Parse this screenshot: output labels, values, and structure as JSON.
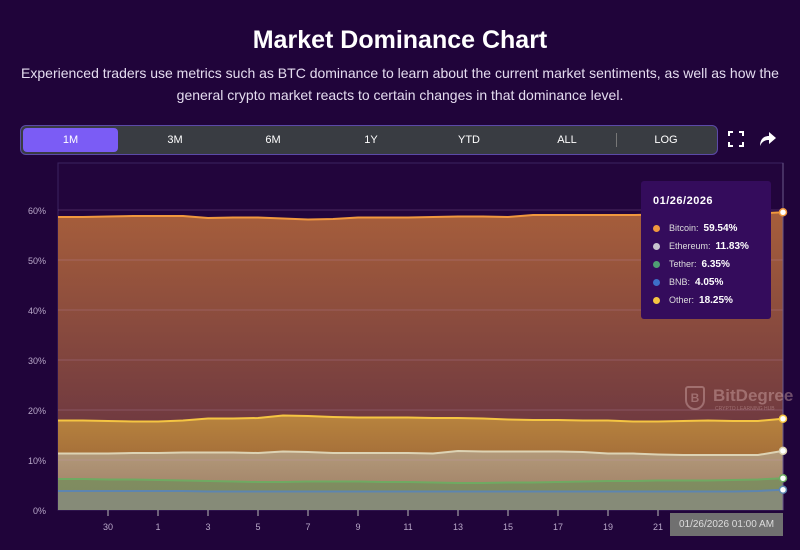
{
  "header": {
    "title": "Market Dominance Chart",
    "subtitle": "Experienced traders use metrics such as BTC dominance to learn about the current market sentiments, as well as how the general crypto market reacts to certain changes in that dominance level."
  },
  "toolbar": {
    "ranges": [
      "1M",
      "3M",
      "6M",
      "1Y",
      "YTD",
      "ALL"
    ],
    "active": "1M",
    "log": "LOG",
    "icons": [
      "fullscreen-icon",
      "share-icon"
    ]
  },
  "tooltip": {
    "date": "01/26/2026",
    "items": [
      {
        "name": "Bitcoin:",
        "value": "59.54%",
        "color": "#f0983e"
      },
      {
        "name": "Ethereum:",
        "value": "11.83%",
        "color": "#c8c4d0"
      },
      {
        "name": "Tether:",
        "value": "6.35%",
        "color": "#4f9e74"
      },
      {
        "name": "BNB:",
        "value": "4.05%",
        "color": "#3d6fc8"
      },
      {
        "name": "Other:",
        "value": "18.25%",
        "color": "#f5c542"
      }
    ]
  },
  "crosshair_label": "01/26/2026 01:00 AM",
  "watermark": {
    "brand": "BitDegree",
    "tagline": "CRYPTO LEARNING HUB"
  },
  "chart_data": {
    "type": "area",
    "title": "Market Dominance Chart",
    "x_start": "12/28",
    "x_tick_labels": [
      "30",
      "1",
      "3",
      "5",
      "7",
      "9",
      "11",
      "13",
      "15",
      "17",
      "19",
      "21"
    ],
    "y_tick_labels": [
      "0%",
      "10%",
      "20%",
      "30%",
      "40%",
      "50%",
      "60%"
    ],
    "ylim": [
      0,
      68
    ],
    "grid": true,
    "series": [
      {
        "name": "Bitcoin",
        "line": "#f0983e",
        "fill": [
          "#a65e3b",
          "#5a2b42"
        ],
        "values": [
          58.6,
          58.6,
          58.7,
          58.8,
          58.8,
          58.8,
          58.4,
          58.5,
          58.5,
          58.3,
          58.1,
          58.2,
          58.5,
          58.5,
          58.5,
          58.6,
          58.7,
          58.7,
          58.6,
          59.0,
          59.0,
          59.0,
          59.0,
          59.0,
          59.1,
          59.1,
          59.2,
          59.2,
          59.3,
          59.54
        ]
      },
      {
        "name": "Other",
        "line": "#f5c542",
        "fill": [
          "#b8843e",
          "#8d5434"
        ],
        "values": [
          17.9,
          17.9,
          17.8,
          17.7,
          17.7,
          17.9,
          18.3,
          18.3,
          18.4,
          18.9,
          18.8,
          18.6,
          18.5,
          18.5,
          18.5,
          18.4,
          18.4,
          18.3,
          18.1,
          18.0,
          18.0,
          17.9,
          17.9,
          17.7,
          17.7,
          17.8,
          17.9,
          17.8,
          17.8,
          18.25
        ]
      },
      {
        "name": "Ethereum",
        "line": "#ddd3b4",
        "fill": [
          "#b39a7a",
          "#9a7860"
        ],
        "values": [
          11.3,
          11.3,
          11.3,
          11.4,
          11.4,
          11.5,
          11.5,
          11.5,
          11.4,
          11.7,
          11.6,
          11.4,
          11.4,
          11.4,
          11.4,
          11.3,
          11.8,
          11.7,
          11.7,
          11.7,
          11.7,
          11.6,
          11.3,
          11.3,
          11.1,
          11.0,
          11.0,
          11.0,
          11.0,
          11.83
        ]
      },
      {
        "name": "Tether",
        "line": "#6faa62",
        "fill": [
          "#808c60",
          "#7d8a60"
        ],
        "values": [
          6.2,
          6.2,
          6.1,
          6.1,
          6.0,
          5.9,
          5.8,
          5.7,
          5.6,
          5.6,
          5.7,
          5.7,
          5.7,
          5.6,
          5.6,
          5.5,
          5.4,
          5.4,
          5.5,
          5.5,
          5.6,
          5.7,
          5.8,
          5.8,
          5.9,
          5.9,
          5.9,
          6.0,
          6.1,
          6.35
        ]
      },
      {
        "name": "BNB",
        "line": "#5d85b0",
        "fill": [
          "#868b78",
          "#868b78"
        ],
        "values": [
          3.8,
          3.8,
          3.8,
          3.8,
          3.8,
          3.8,
          3.7,
          3.7,
          3.7,
          3.7,
          3.7,
          3.7,
          3.7,
          3.7,
          3.7,
          3.7,
          3.7,
          3.7,
          3.7,
          3.7,
          3.7,
          3.7,
          3.7,
          3.7,
          3.7,
          3.7,
          3.7,
          3.7,
          3.8,
          4.05
        ]
      }
    ]
  }
}
